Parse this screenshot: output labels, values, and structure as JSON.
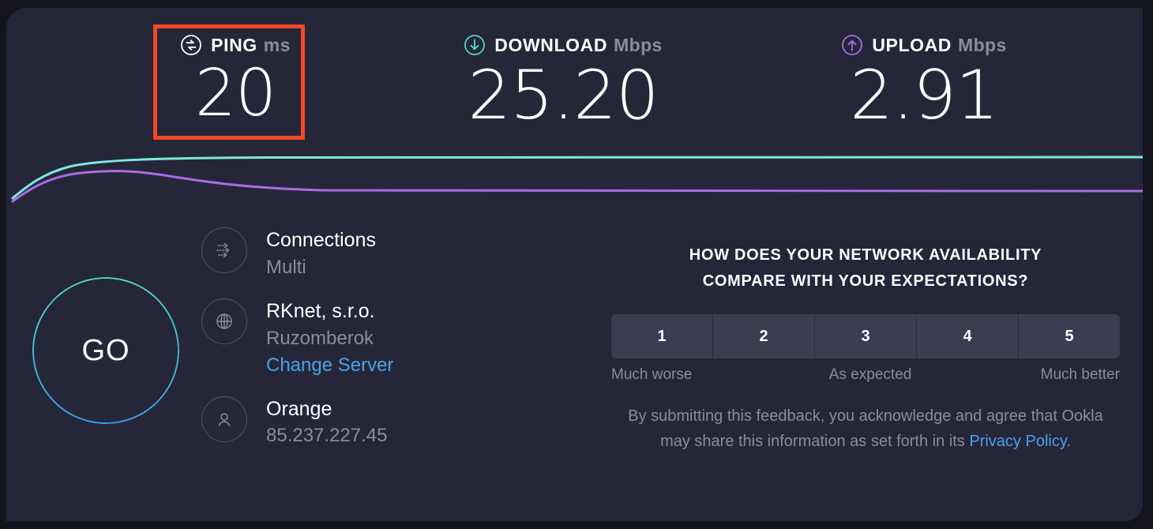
{
  "theme": {
    "page_bg": "#14141d",
    "panel_bg": "#262639",
    "accent_teal": "#4fd8c4",
    "accent_purple": "#a86ce8",
    "accent_blue": "#4aa3e8",
    "highlight_red": "#f04a28",
    "muted_text": "#8b8ba3"
  },
  "results": {
    "ping": {
      "icon": "ping-icon",
      "label": "PING",
      "unit": "ms",
      "value": "20",
      "highlighted": true
    },
    "download": {
      "icon": "download-arrow-icon",
      "label": "DOWNLOAD",
      "unit": "Mbps",
      "value": "25.20"
    },
    "upload": {
      "icon": "upload-arrow-icon",
      "label": "UPLOAD",
      "unit": "Mbps",
      "value": "2.91"
    }
  },
  "chart_data": {
    "type": "line",
    "title": "",
    "xlabel": "",
    "ylabel": "",
    "grid": false,
    "legend": "none",
    "series": [
      {
        "name": "download",
        "color": "#7be8e0",
        "points": [
          [
            8,
            66
          ],
          [
            30,
            45
          ],
          [
            60,
            30
          ],
          [
            100,
            22
          ],
          [
            150,
            18
          ],
          [
            220,
            16
          ],
          [
            320,
            15
          ],
          [
            500,
            15
          ],
          [
            800,
            14
          ],
          [
            1100,
            14
          ],
          [
            1439,
            14
          ]
        ]
      },
      {
        "name": "upload",
        "color": "#a86ce8",
        "points": [
          [
            8,
            70
          ],
          [
            40,
            50
          ],
          [
            80,
            36
          ],
          [
            130,
            32
          ],
          [
            180,
            33
          ],
          [
            240,
            40
          ],
          [
            300,
            48
          ],
          [
            360,
            53
          ],
          [
            430,
            56
          ],
          [
            560,
            57
          ],
          [
            800,
            57
          ],
          [
            1100,
            57
          ],
          [
            1439,
            57
          ]
        ]
      }
    ]
  },
  "go_button": {
    "label": "GO"
  },
  "connection_info": [
    {
      "icon": "connections-icon",
      "primary": "Connections",
      "secondary": "Multi",
      "link": null
    },
    {
      "icon": "globe-icon",
      "primary": "RKnet, s.r.o.",
      "secondary": "Ruzomberok",
      "link": "Change Server"
    },
    {
      "icon": "person-icon",
      "primary": "Orange",
      "secondary": "85.237.227.45",
      "link": null
    }
  ],
  "survey": {
    "question_line1": "HOW DOES YOUR NETWORK AVAILABILITY",
    "question_line2": "COMPARE WITH YOUR EXPECTATIONS?",
    "ratings": [
      "1",
      "2",
      "3",
      "4",
      "5"
    ],
    "scale_labels": {
      "low": "Much worse",
      "mid": "As expected",
      "high": "Much better"
    },
    "disclaimer_part1": "By submitting this feedback, you acknowledge and agree that Ookla may share this information as set forth in its ",
    "disclaimer_link": "Privacy Policy",
    "disclaimer_part2": "."
  }
}
